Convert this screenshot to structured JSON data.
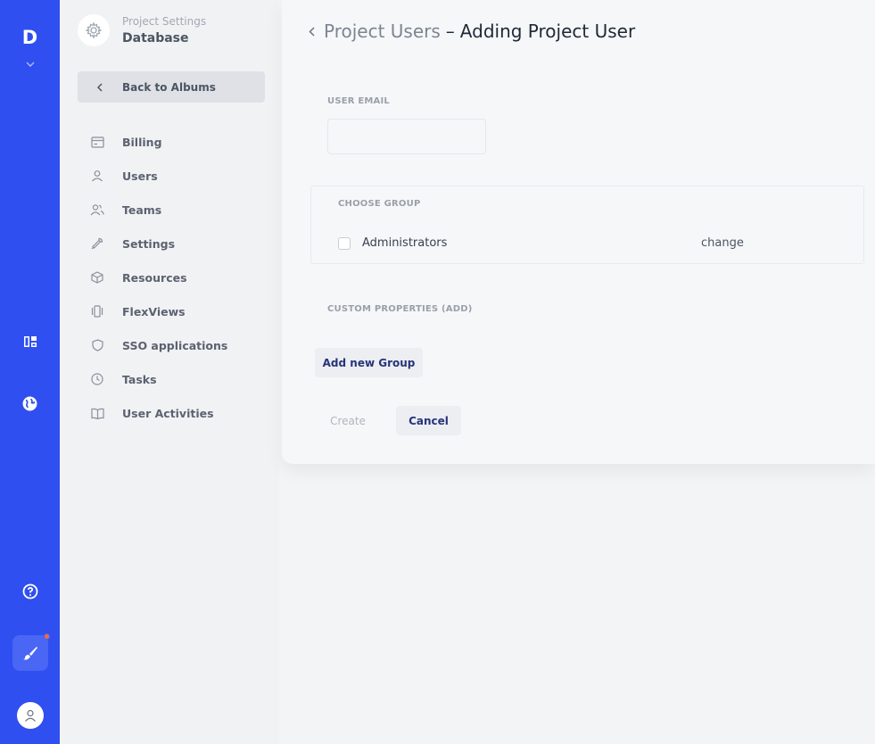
{
  "rail": {
    "logo": "D",
    "colors": {
      "background": "#2f4ff0",
      "notification": "#f26b3a"
    },
    "icons": [
      "chevron-down-icon",
      "dashboard-icon",
      "globe-icon",
      "help-icon",
      "brush-icon",
      "user-icon"
    ]
  },
  "sidebar": {
    "project_subtitle": "Project Settings",
    "project_title": "Database",
    "back_label": "Back to Albums",
    "items": [
      {
        "label": "Billing",
        "icon": "billing-icon"
      },
      {
        "label": "Users",
        "icon": "user-icon"
      },
      {
        "label": "Teams",
        "icon": "teams-icon"
      },
      {
        "label": "Settings",
        "icon": "wrench-icon"
      },
      {
        "label": "Resources",
        "icon": "cube-icon"
      },
      {
        "label": "FlexViews",
        "icon": "flexviews-icon"
      },
      {
        "label": "SSO applications",
        "icon": "shield-icon"
      },
      {
        "label": "Tasks",
        "icon": "clock-icon"
      },
      {
        "label": "User Activities",
        "icon": "book-icon"
      }
    ]
  },
  "main": {
    "breadcrumb": "Project Users",
    "separator": "–",
    "title": "Adding Project User",
    "email_label": "USER EMAIL",
    "email_value": "",
    "group_label": "CHOOSE GROUP",
    "group_name": "Administrators",
    "change_label": "change",
    "custom_props_label": "CUSTOM PROPERTIES (ADD)",
    "add_group_label": "Add new Group",
    "create_label": "Create",
    "cancel_label": "Cancel"
  }
}
